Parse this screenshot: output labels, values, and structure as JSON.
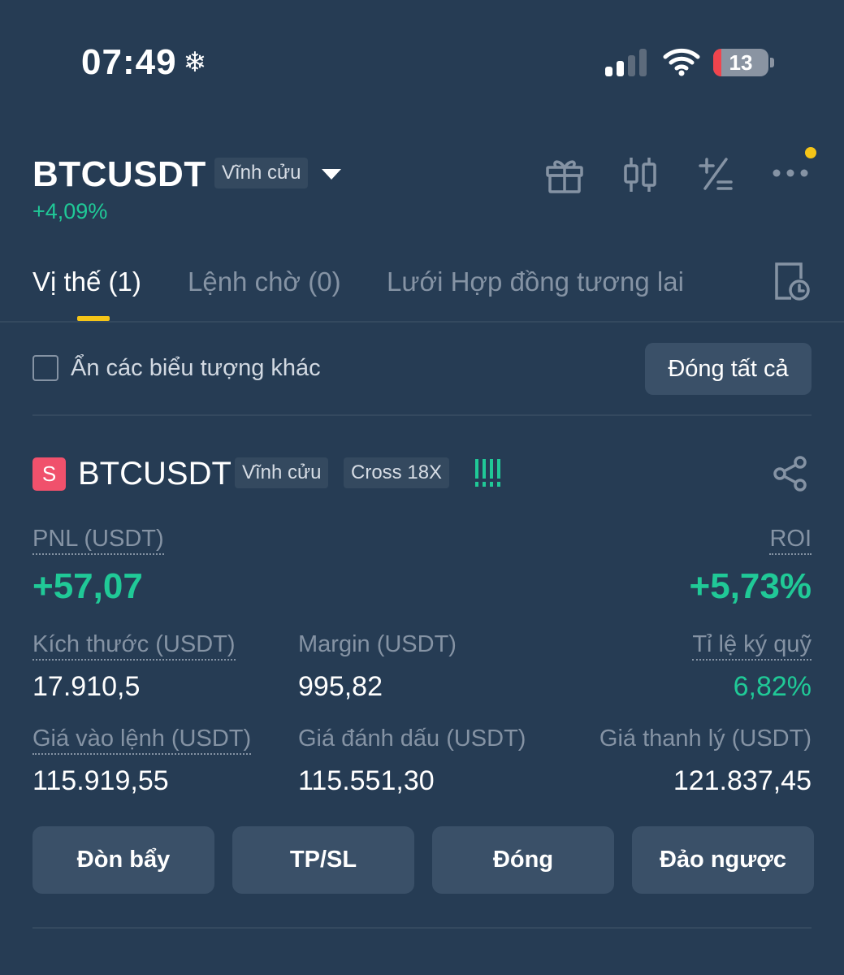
{
  "status_bar": {
    "time": "07:49",
    "battery": "13"
  },
  "header": {
    "symbol": "BTCUSDT",
    "contract_type": "Vĩnh cửu",
    "change": "+4,09%",
    "icons": [
      "gift-icon",
      "candlestick-icon",
      "plus-minus-icon",
      "more-icon"
    ]
  },
  "tabs": [
    {
      "label": "Vị thế (1)",
      "active": true
    },
    {
      "label": "Lệnh chờ (0)",
      "active": false
    },
    {
      "label": "Lưới Hợp đồng tương lai",
      "active": false
    }
  ],
  "filter": {
    "hide_other_symbols": "Ẩn các biểu tượng khác",
    "close_all": "Đóng tất cả"
  },
  "position": {
    "side": "S",
    "symbol": "BTCUSDT",
    "contract_type": "Vĩnh cửu",
    "margin_mode": "Cross 18X",
    "pnl_label": "PNL (USDT)",
    "pnl_value": "+57,07",
    "roi_label": "ROI",
    "roi_value": "+5,73%",
    "size_label": "Kích thước (USDT)",
    "size_value": "17.910,5",
    "margin_label": "Margin (USDT)",
    "margin_value": "995,82",
    "margin_ratio_label": "Tỉ lệ ký quỹ",
    "margin_ratio_value": "6,82%",
    "entry_label": "Giá vào lệnh (USDT)",
    "entry_value": "115.919,55",
    "mark_label": "Giá đánh dấu (USDT)",
    "mark_value": "115.551,30",
    "liq_label": "Giá thanh lý (USDT)",
    "liq_value": "121.837,45"
  },
  "actions": {
    "leverage": "Đòn bẩy",
    "tpsl": "TP/SL",
    "close": "Đóng",
    "reverse": "Đảo ngược"
  },
  "colors": {
    "background": "#263c54",
    "accent_yellow": "#f5c518",
    "profit_green": "#20c997",
    "short_red": "#f0516c"
  }
}
